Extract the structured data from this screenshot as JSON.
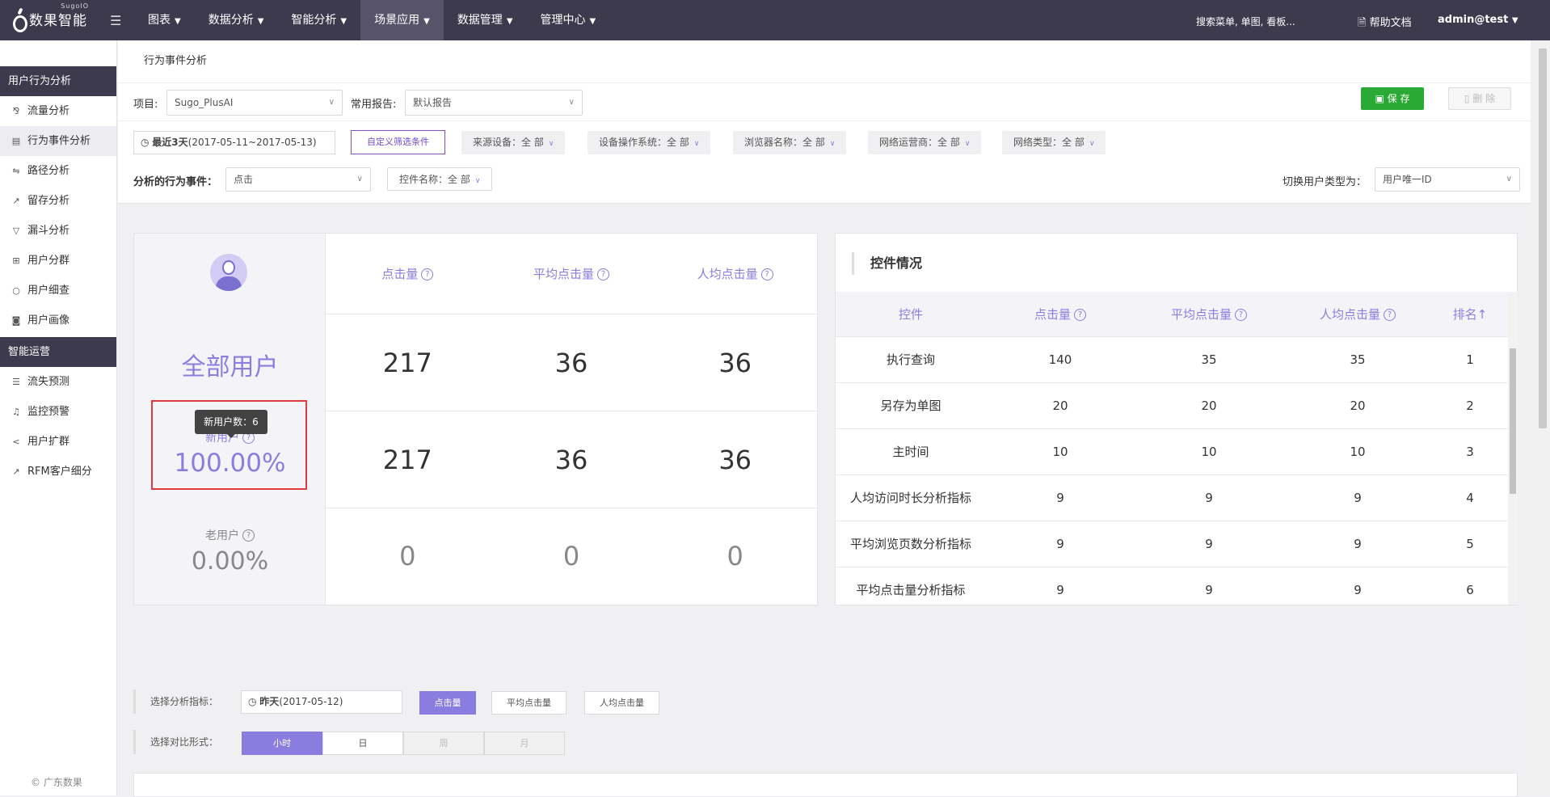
{
  "topbar": {
    "brand": "数果智能",
    "brand_sub": "SugoIO",
    "nav": [
      {
        "label": "图表"
      },
      {
        "label": "数据分析"
      },
      {
        "label": "智能分析"
      },
      {
        "label": "场景应用"
      },
      {
        "label": "数据管理"
      },
      {
        "label": "管理中心"
      }
    ],
    "search_placeholder": "搜索菜单, 单图, 看板...",
    "help": "帮助文档",
    "user": "admin@test"
  },
  "sidebar": {
    "group1": "用户行为分析",
    "items1": [
      {
        "label": "流量分析",
        "icon": "traffic-icon"
      },
      {
        "label": "行为事件分析",
        "icon": "event-icon"
      },
      {
        "label": "路径分析",
        "icon": "path-icon"
      },
      {
        "label": "留存分析",
        "icon": "retention-icon"
      },
      {
        "label": "漏斗分析",
        "icon": "funnel-icon"
      },
      {
        "label": "用户分群",
        "icon": "group-icon"
      },
      {
        "label": "用户细查",
        "icon": "search-icon"
      },
      {
        "label": "用户画像",
        "icon": "portrait-icon"
      }
    ],
    "group2": "智能运营",
    "items2": [
      {
        "label": "流失预测",
        "icon": "list-icon"
      },
      {
        "label": "监控预警",
        "icon": "bell-icon"
      },
      {
        "label": "用户扩群",
        "icon": "share-icon"
      },
      {
        "label": "RFM客户细分",
        "icon": "chart-icon"
      }
    ],
    "footer": "© 广东数果"
  },
  "page": {
    "title": "行为事件分析",
    "project_label": "项目:",
    "project_value": "Sugo_PlusAI",
    "report_label": "常用报告:",
    "report_value": "默认报告",
    "save": "保 存",
    "delete": "删 除"
  },
  "filters": {
    "date_bold": "最近3天",
    "date_range": "(2017-05-11~2017-05-13)",
    "custom": "自定义筛选条件",
    "chips": [
      "来源设备：全 部",
      "设备操作系统：全 部",
      "浏览器名称：全 部",
      "网络运营商：全 部",
      "网络类型：全 部"
    ],
    "event_label": "分析的行为事件：",
    "event_value": "点击",
    "control_chip": "控件名称：全 部",
    "user_type_label": "切换用户类型为：",
    "user_type_value": "用户唯一ID"
  },
  "summary": {
    "all_users": "全部用户",
    "new_users_label": "新用户",
    "new_users_pct": "100.00%",
    "tooltip": "新用户数：6",
    "old_users_label": "老用户",
    "old_users_pct": "0.00%",
    "headers": [
      "点击量",
      "平均点击量",
      "人均点击量"
    ],
    "rows": [
      [
        "217",
        "36",
        "36"
      ],
      [
        "217",
        "36",
        "36"
      ],
      [
        "0",
        "0",
        "0"
      ]
    ]
  },
  "controls": {
    "title": "控件情况",
    "headers": [
      "控件",
      "点击量",
      "平均点击量",
      "人均点击量",
      "排名↑"
    ],
    "rows": [
      [
        "执行查询",
        "140",
        "35",
        "35",
        "1"
      ],
      [
        "另存为单图",
        "20",
        "20",
        "20",
        "2"
      ],
      [
        "主时间",
        "10",
        "10",
        "10",
        "3"
      ],
      [
        "人均访问时长分析指标",
        "9",
        "9",
        "9",
        "4"
      ],
      [
        "平均浏览页数分析指标",
        "9",
        "9",
        "9",
        "5"
      ],
      [
        "平均点击量分析指标",
        "9",
        "9",
        "9",
        "6"
      ]
    ]
  },
  "bottom": {
    "metric_label": "选择分析指标：",
    "date_bold": "昨天",
    "date_value": "(2017-05-12)",
    "metrics": [
      "点击量",
      "平均点击量",
      "人均点击量"
    ],
    "compare_label": "选择对比形式：",
    "granularity": [
      "小时",
      "日",
      "周",
      "月"
    ]
  }
}
